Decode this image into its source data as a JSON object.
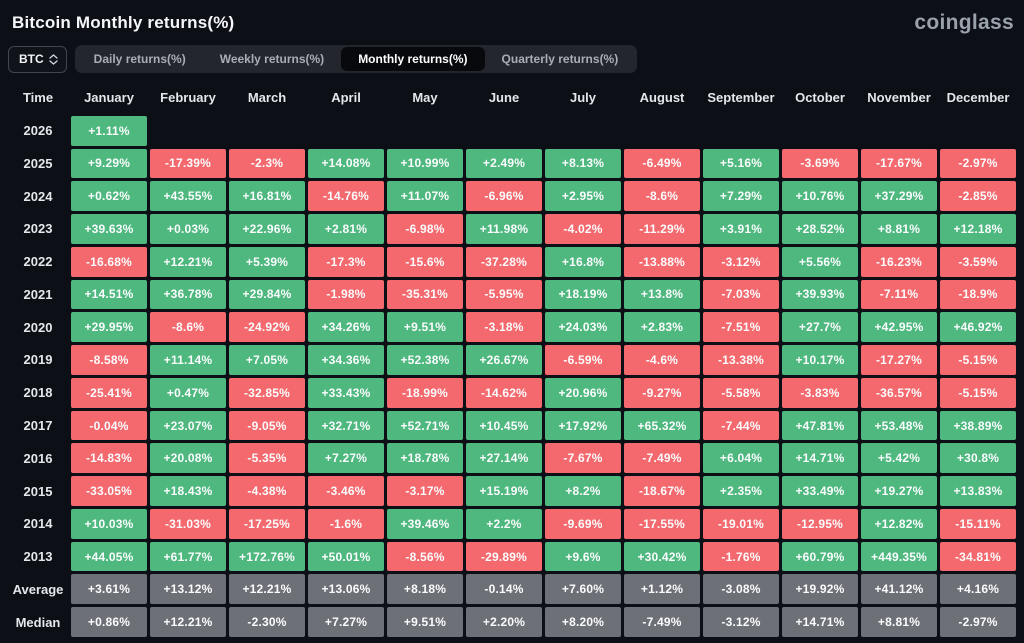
{
  "page": {
    "title": "Bitcoin Monthly returns(%)",
    "logo": "coinglass"
  },
  "controls": {
    "symbol_selector": {
      "value": "BTC"
    },
    "tabs": [
      {
        "label": "Daily returns(%)",
        "active": false
      },
      {
        "label": "Weekly returns(%)",
        "active": false
      },
      {
        "label": "Monthly returns(%)",
        "active": true
      },
      {
        "label": "Quarterly returns(%)",
        "active": false
      }
    ]
  },
  "chart_data": {
    "type": "heatmap",
    "title": "Bitcoin Monthly returns(%)",
    "columns": [
      "Time",
      "January",
      "February",
      "March",
      "April",
      "May",
      "June",
      "July",
      "August",
      "September",
      "October",
      "November",
      "December"
    ],
    "colors": {
      "positive": "#4eb87f",
      "negative": "#f4696e",
      "summary": "#6d7076"
    },
    "rows": [
      {
        "label": "2026",
        "type": "year",
        "values": [
          "+1.11%",
          null,
          null,
          null,
          null,
          null,
          null,
          null,
          null,
          null,
          null,
          null
        ]
      },
      {
        "label": "2025",
        "type": "year",
        "values": [
          "+9.29%",
          "-17.39%",
          "-2.3%",
          "+14.08%",
          "+10.99%",
          "+2.49%",
          "+8.13%",
          "-6.49%",
          "+5.16%",
          "-3.69%",
          "-17.67%",
          "-2.97%"
        ]
      },
      {
        "label": "2024",
        "type": "year",
        "values": [
          "+0.62%",
          "+43.55%",
          "+16.81%",
          "-14.76%",
          "+11.07%",
          "-6.96%",
          "+2.95%",
          "-8.6%",
          "+7.29%",
          "+10.76%",
          "+37.29%",
          "-2.85%"
        ]
      },
      {
        "label": "2023",
        "type": "year",
        "values": [
          "+39.63%",
          "+0.03%",
          "+22.96%",
          "+2.81%",
          "-6.98%",
          "+11.98%",
          "-4.02%",
          "-11.29%",
          "+3.91%",
          "+28.52%",
          "+8.81%",
          "+12.18%"
        ]
      },
      {
        "label": "2022",
        "type": "year",
        "values": [
          "-16.68%",
          "+12.21%",
          "+5.39%",
          "-17.3%",
          "-15.6%",
          "-37.28%",
          "+16.8%",
          "-13.88%",
          "-3.12%",
          "+5.56%",
          "-16.23%",
          "-3.59%"
        ]
      },
      {
        "label": "2021",
        "type": "year",
        "values": [
          "+14.51%",
          "+36.78%",
          "+29.84%",
          "-1.98%",
          "-35.31%",
          "-5.95%",
          "+18.19%",
          "+13.8%",
          "-7.03%",
          "+39.93%",
          "-7.11%",
          "-18.9%"
        ]
      },
      {
        "label": "2020",
        "type": "year",
        "values": [
          "+29.95%",
          "-8.6%",
          "-24.92%",
          "+34.26%",
          "+9.51%",
          "-3.18%",
          "+24.03%",
          "+2.83%",
          "-7.51%",
          "+27.7%",
          "+42.95%",
          "+46.92%"
        ]
      },
      {
        "label": "2019",
        "type": "year",
        "values": [
          "-8.58%",
          "+11.14%",
          "+7.05%",
          "+34.36%",
          "+52.38%",
          "+26.67%",
          "-6.59%",
          "-4.6%",
          "-13.38%",
          "+10.17%",
          "-17.27%",
          "-5.15%"
        ]
      },
      {
        "label": "2018",
        "type": "year",
        "values": [
          "-25.41%",
          "+0.47%",
          "-32.85%",
          "+33.43%",
          "-18.99%",
          "-14.62%",
          "+20.96%",
          "-9.27%",
          "-5.58%",
          "-3.83%",
          "-36.57%",
          "-5.15%"
        ]
      },
      {
        "label": "2017",
        "type": "year",
        "values": [
          "-0.04%",
          "+23.07%",
          "-9.05%",
          "+32.71%",
          "+52.71%",
          "+10.45%",
          "+17.92%",
          "+65.32%",
          "-7.44%",
          "+47.81%",
          "+53.48%",
          "+38.89%"
        ]
      },
      {
        "label": "2016",
        "type": "year",
        "values": [
          "-14.83%",
          "+20.08%",
          "-5.35%",
          "+7.27%",
          "+18.78%",
          "+27.14%",
          "-7.67%",
          "-7.49%",
          "+6.04%",
          "+14.71%",
          "+5.42%",
          "+30.8%"
        ]
      },
      {
        "label": "2015",
        "type": "year",
        "values": [
          "-33.05%",
          "+18.43%",
          "-4.38%",
          "-3.46%",
          "-3.17%",
          "+15.19%",
          "+8.2%",
          "-18.67%",
          "+2.35%",
          "+33.49%",
          "+19.27%",
          "+13.83%"
        ]
      },
      {
        "label": "2014",
        "type": "year",
        "values": [
          "+10.03%",
          "-31.03%",
          "-17.25%",
          "-1.6%",
          "+39.46%",
          "+2.2%",
          "-9.69%",
          "-17.55%",
          "-19.01%",
          "-12.95%",
          "+12.82%",
          "-15.11%"
        ]
      },
      {
        "label": "2013",
        "type": "year",
        "values": [
          "+44.05%",
          "+61.77%",
          "+172.76%",
          "+50.01%",
          "-8.56%",
          "-29.89%",
          "+9.6%",
          "+30.42%",
          "-1.76%",
          "+60.79%",
          "+449.35%",
          "-34.81%"
        ]
      },
      {
        "label": "Average",
        "type": "summary",
        "values": [
          "+3.61%",
          "+13.12%",
          "+12.21%",
          "+13.06%",
          "+8.18%",
          "-0.14%",
          "+7.60%",
          "+1.12%",
          "-3.08%",
          "+19.92%",
          "+41.12%",
          "+4.16%"
        ]
      },
      {
        "label": "Median",
        "type": "summary",
        "values": [
          "+0.86%",
          "+12.21%",
          "-2.30%",
          "+7.27%",
          "+9.51%",
          "+2.20%",
          "+8.20%",
          "-7.49%",
          "-3.12%",
          "+14.71%",
          "+8.81%",
          "-2.97%"
        ]
      }
    ]
  }
}
